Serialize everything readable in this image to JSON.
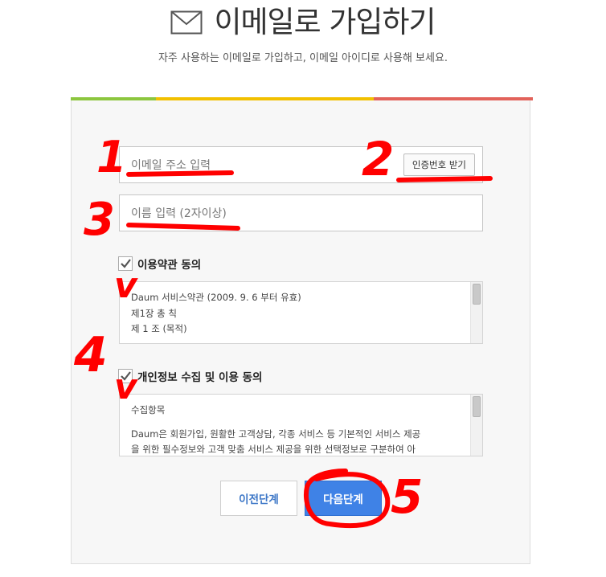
{
  "header": {
    "icon": "envelope-icon",
    "title": "이메일로 가입하기",
    "subtitle": "자주 사용하는 이메일로 가입하고, 이메일 아이디로 사용해 보세요."
  },
  "form": {
    "email_placeholder": "이메일 주소 입력",
    "auth_button": "인증번호 받기",
    "name_placeholder": "이름 입력 (2자이상)"
  },
  "terms": {
    "checked": true,
    "label": "이용약관 동의",
    "lines": [
      "Daum 서비스약관 (2009. 9. 6 부터 유효)",
      "제1장 총 칙",
      "제 1 조 (목적)"
    ]
  },
  "privacy": {
    "checked": true,
    "label": "개인정보 수집 및 이용 동의",
    "lines": [
      "수집항목",
      "Daum은 회원가입, 원활한 고객상담, 각종 서비스 등 기본적인 서비스 제공",
      "을 위한 필수정보와 고객 맞춤 서비스 제공을 위한 선택정보로 구분하여 아"
    ]
  },
  "buttons": {
    "prev": "이전단계",
    "next": "다음단계"
  },
  "colors": {
    "progress_green": "#8cc63e",
    "progress_yellow": "#f2c000",
    "progress_red": "#e2625a",
    "accent_blue": "#3f82e6",
    "annotation_red": "#ff0000"
  },
  "annotations": {
    "n1": "1",
    "n2": "2",
    "n3": "3",
    "n4": "4",
    "n5": "5",
    "check1": "v",
    "check2": "v"
  }
}
